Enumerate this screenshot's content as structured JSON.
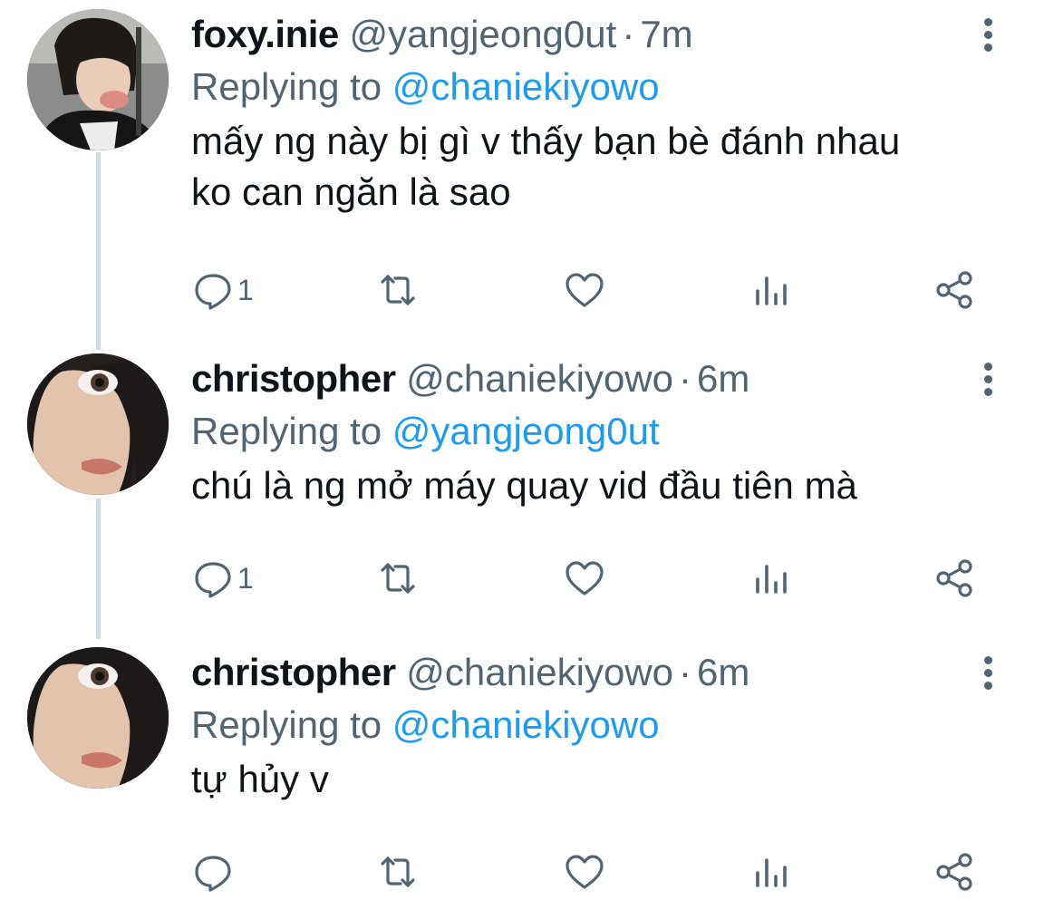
{
  "colors": {
    "text": "#0f1419",
    "secondary": "#536471",
    "accent": "#1d9bf0",
    "thread_line": "#cfd9de"
  },
  "tweets": [
    {
      "name": "foxy.inie",
      "handle": "@yangjeong0ut",
      "dot": "·",
      "time": "7m",
      "replying_prefix": "Replying to",
      "replying_to": "@chaniekiyowo",
      "text_line1": "mấy ng này bị gì v thấy bạn bè đánh nhau",
      "text_line2": "ko can ngăn là sao",
      "reply_count": "1",
      "icons": [
        "reply-icon",
        "retweet-icon",
        "like-icon",
        "analytics-icon",
        "share-icon",
        "more-icon"
      ]
    },
    {
      "name": "christopher",
      "handle": "@chaniekiyowo",
      "dot": "·",
      "time": "6m",
      "replying_prefix": "Replying to",
      "replying_to": "@yangjeong0ut",
      "text_line1": "chú là ng mở máy quay vid đầu tiên mà",
      "text_line2": "",
      "reply_count": "1",
      "icons": [
        "reply-icon",
        "retweet-icon",
        "like-icon",
        "analytics-icon",
        "share-icon",
        "more-icon"
      ]
    },
    {
      "name": "christopher",
      "handle": "@chaniekiyowo",
      "dot": "·",
      "time": "6m",
      "replying_prefix": "Replying to",
      "replying_to": "@chaniekiyowo",
      "text_line1": "tự hủy v",
      "text_line2": "",
      "reply_count": "",
      "icons": [
        "reply-icon",
        "retweet-icon",
        "like-icon",
        "analytics-icon",
        "share-icon",
        "more-icon"
      ]
    }
  ]
}
